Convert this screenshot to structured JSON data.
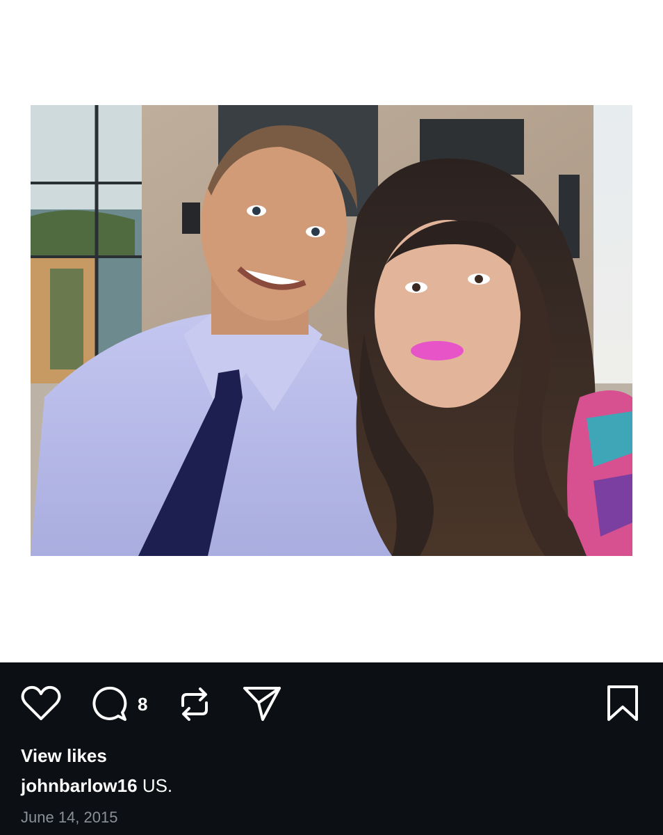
{
  "post": {
    "image": {
      "description_icon": "photo-icon"
    },
    "actions": {
      "like_icon": "heart-icon",
      "comment_icon": "comment-icon",
      "comment_count": "8",
      "repost_icon": "repost-icon",
      "share_icon": "send-icon",
      "save_icon": "bookmark-icon"
    },
    "view_likes_label": "View likes",
    "username": "johnbarlow16",
    "caption_text": "US.",
    "date": "June 14, 2015"
  },
  "colors": {
    "bar_background": "#0c0f14",
    "text_primary": "#ffffff",
    "text_secondary": "#8b9098"
  }
}
